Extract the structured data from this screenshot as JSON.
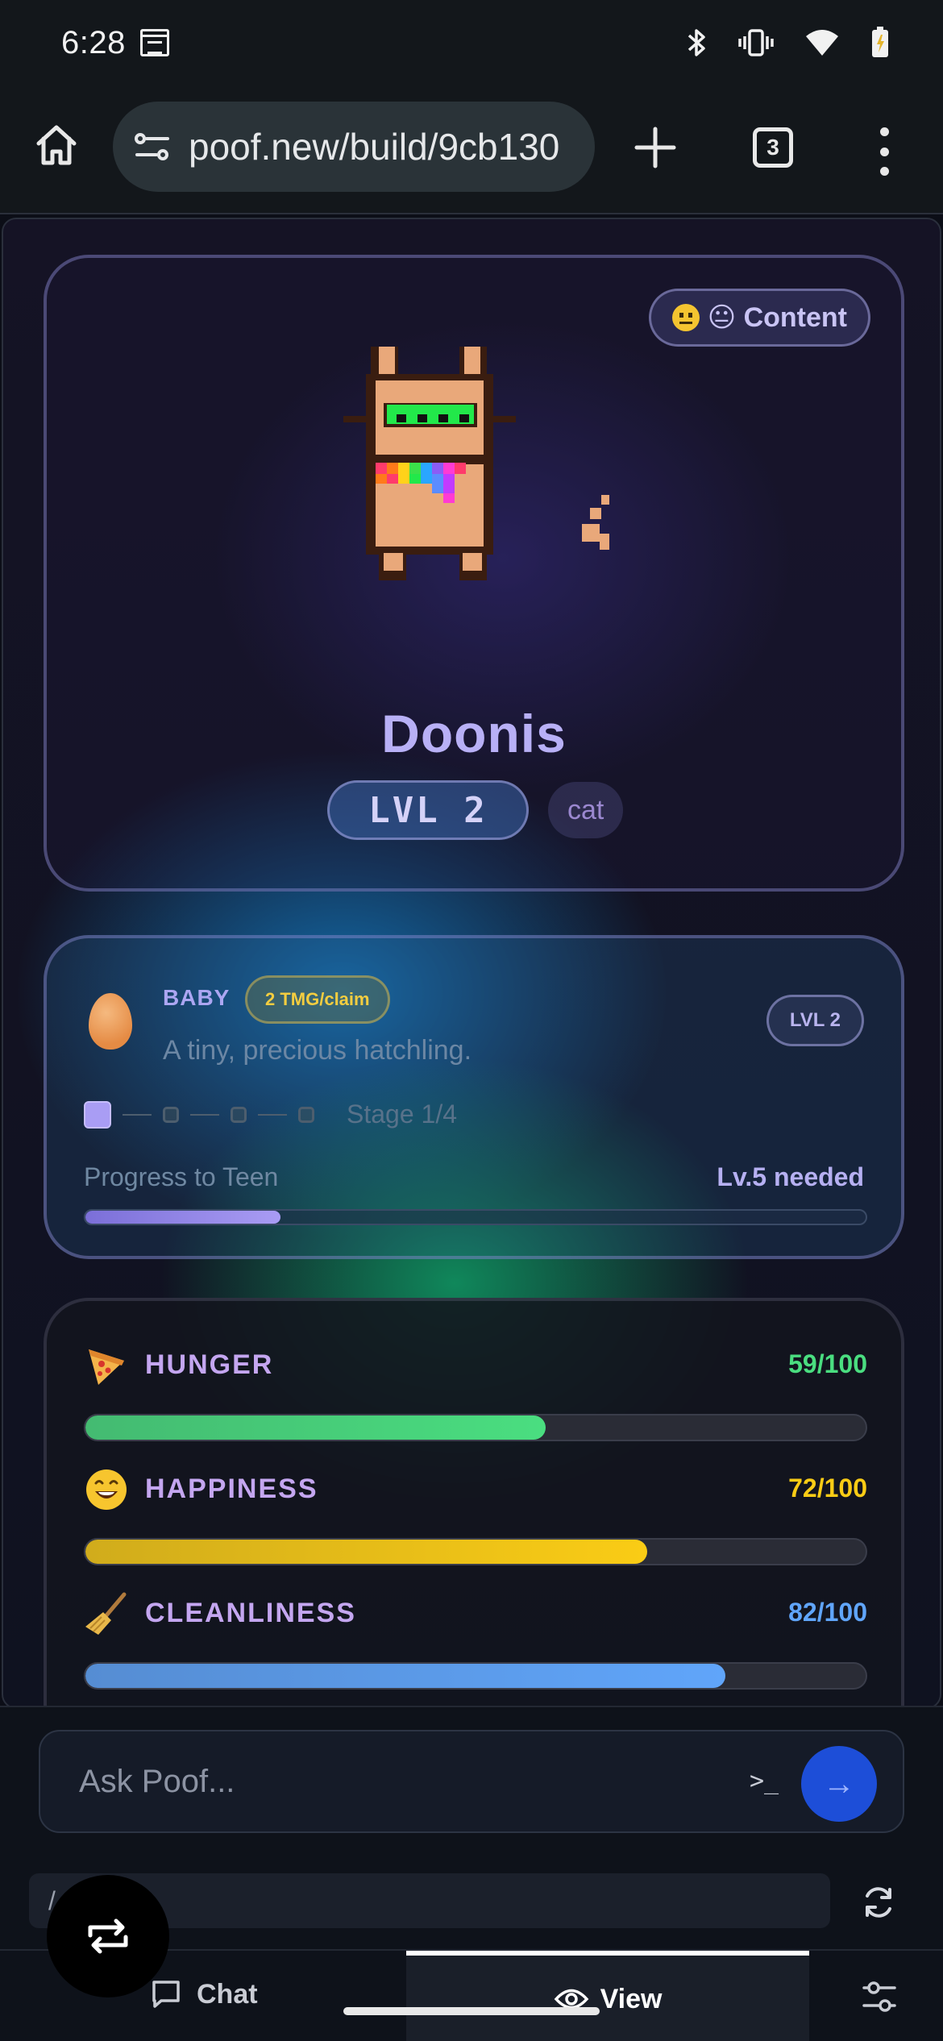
{
  "status_bar": {
    "time": "6:28"
  },
  "browser": {
    "url": "poof.new/build/9cb130",
    "tab_count": "3"
  },
  "pet": {
    "mood": "😐 Content",
    "name": "Doonis",
    "level_label": "LVL 2",
    "species": "cat"
  },
  "stage": {
    "name": "BABY",
    "reward": "2 TMG/claim",
    "description": "A tiny, precious hatchling.",
    "level_badge": "LVL 2",
    "stage_count": "Stage 1/4",
    "progress_label": "Progress to Teen",
    "progress_requirement": "Lv.5 needed",
    "progress_fraction": 0.25
  },
  "stats": [
    {
      "name": "HUNGER",
      "value_text": "59/100",
      "value": 59,
      "icon": "pizza-icon",
      "color": "#4ade80"
    },
    {
      "name": "HAPPINESS",
      "value_text": "72/100",
      "value": 72,
      "icon": "smile-icon",
      "color": "#facc15"
    },
    {
      "name": "CLEANLINESS",
      "value_text": "82/100",
      "value": 82,
      "icon": "broom-icon",
      "color": "#60a5fa"
    }
  ],
  "chat_input": {
    "placeholder": "Ask Poof..."
  },
  "url_strip": {
    "path": "/"
  },
  "bottom_nav": {
    "chat_label": "Chat",
    "view_label": "View"
  }
}
